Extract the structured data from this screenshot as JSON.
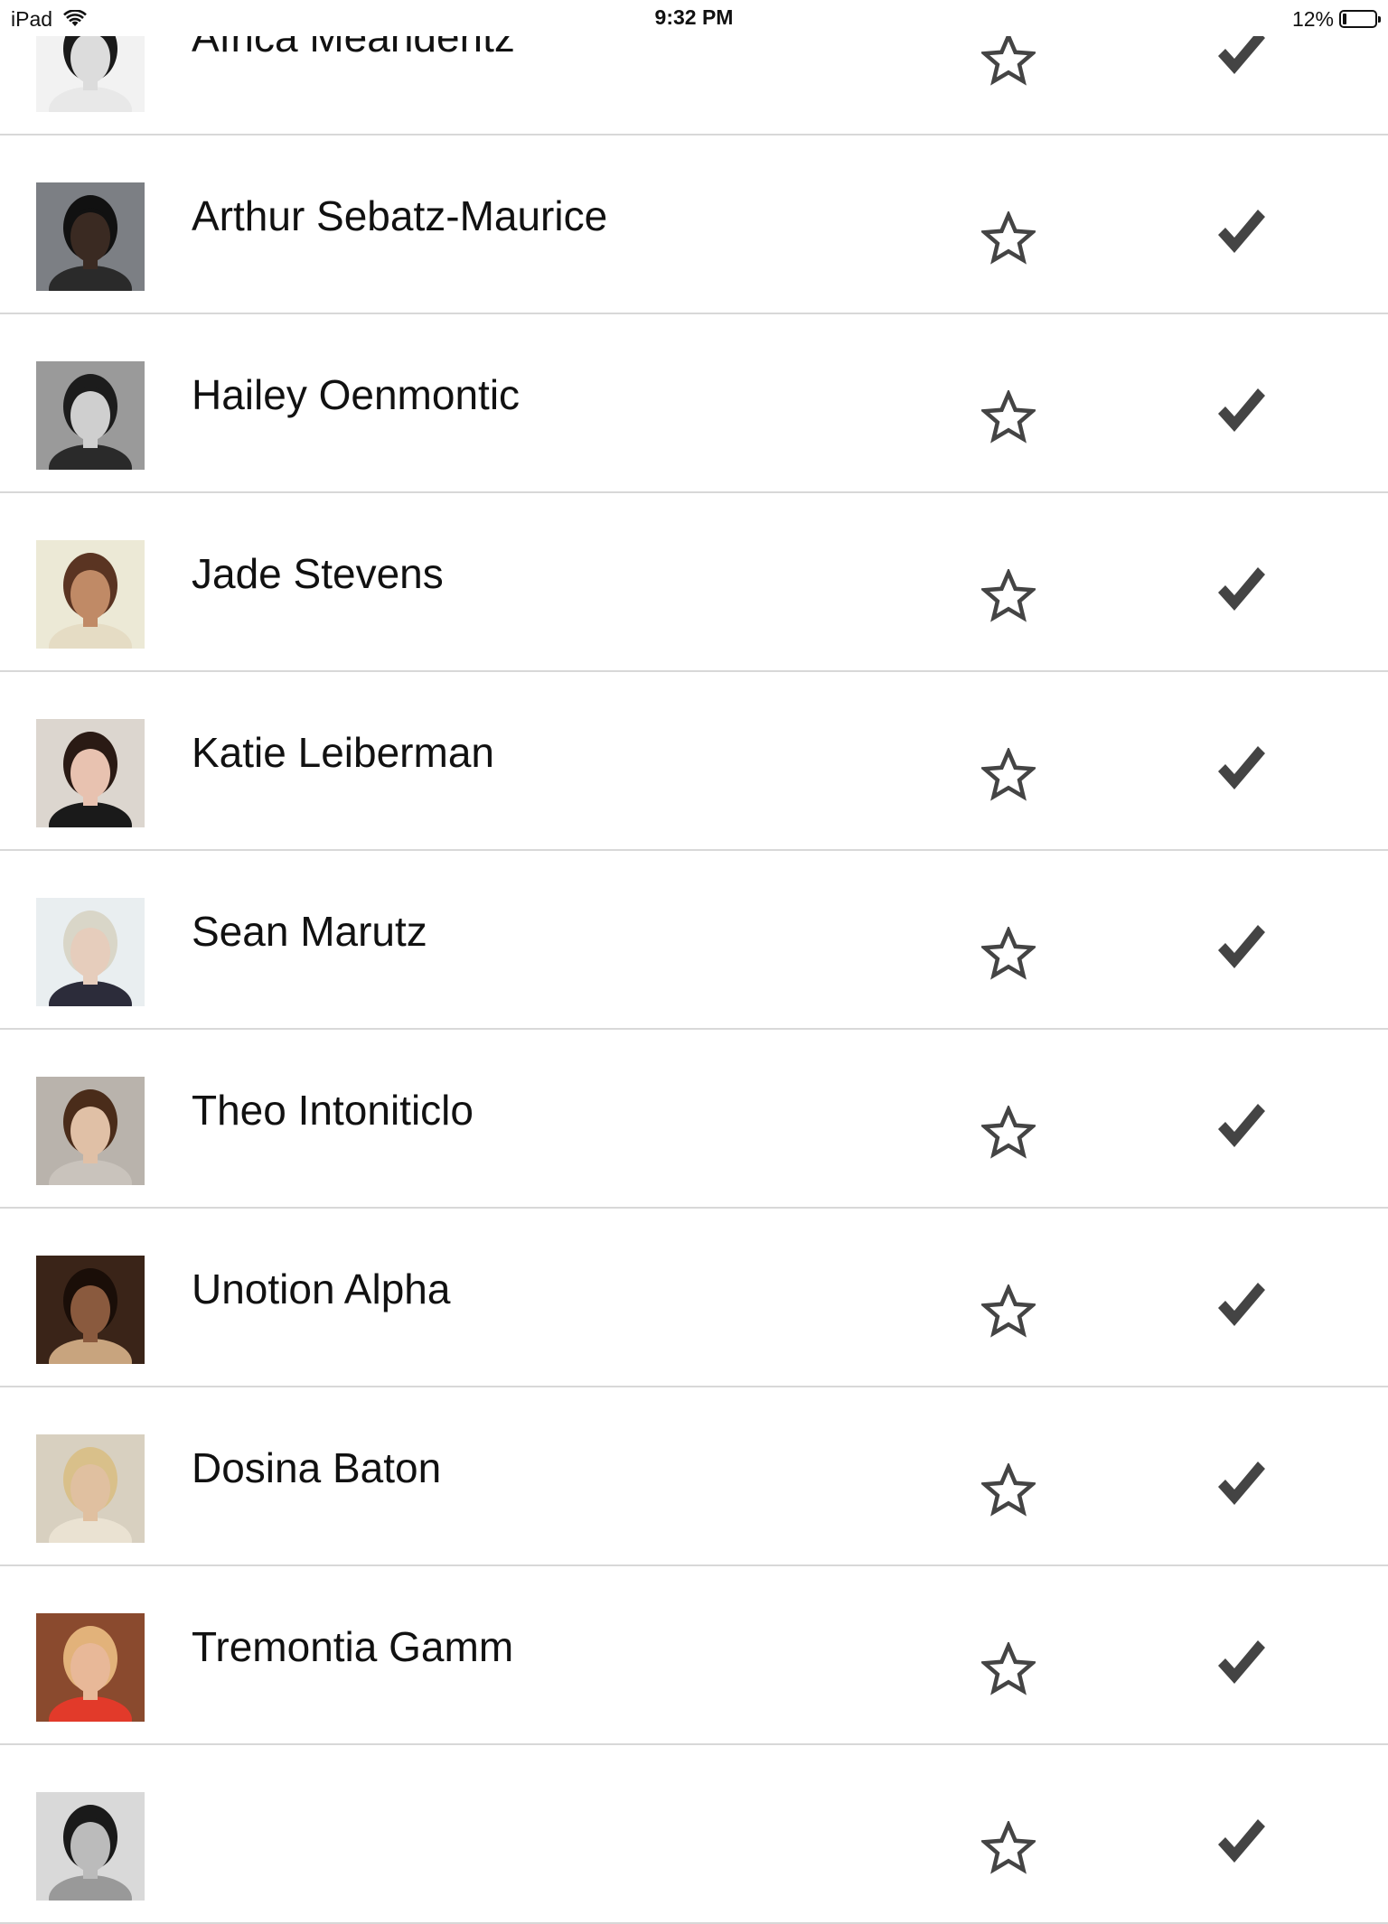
{
  "status_bar": {
    "device": "iPad",
    "time": "9:32 PM",
    "battery": "12%",
    "battery_level": 0.12
  },
  "people": [
    {
      "name": "Africa Meanderitz",
      "avatar": "portrait-bw-woman",
      "favorited": false,
      "selected": true
    },
    {
      "name": "Arthur Sebatz-Maurice",
      "avatar": "portrait-man-grey-bg",
      "favorited": false,
      "selected": true
    },
    {
      "name": "Hailey Oenmontic",
      "avatar": "portrait-bw-woman-dark-hair",
      "favorited": false,
      "selected": true
    },
    {
      "name": "Jade Stevens",
      "avatar": "portrait-woman-warm",
      "favorited": false,
      "selected": true
    },
    {
      "name": "Katie Leiberman",
      "avatar": "portrait-woman-dark-hair",
      "favorited": false,
      "selected": true
    },
    {
      "name": "Sean Marutz",
      "avatar": "portrait-man-blond",
      "favorited": false,
      "selected": true
    },
    {
      "name": "Theo Intoniticlo",
      "avatar": "portrait-man-brown-hair",
      "favorited": false,
      "selected": true
    },
    {
      "name": "Unotion Alpha",
      "avatar": "portrait-woman-sepia",
      "favorited": false,
      "selected": true
    },
    {
      "name": "Dosina Baton",
      "avatar": "portrait-woman-blond-sunglasses",
      "favorited": false,
      "selected": true
    },
    {
      "name": "Tremontia Gamm",
      "avatar": "portrait-woman-red-top",
      "favorited": false,
      "selected": true
    },
    {
      "name": "",
      "avatar": "portrait-partial",
      "favorited": false,
      "selected": true
    }
  ],
  "icons": {
    "star": "star-outline-icon",
    "check": "checkmark-icon",
    "icon_color": "#444444"
  }
}
